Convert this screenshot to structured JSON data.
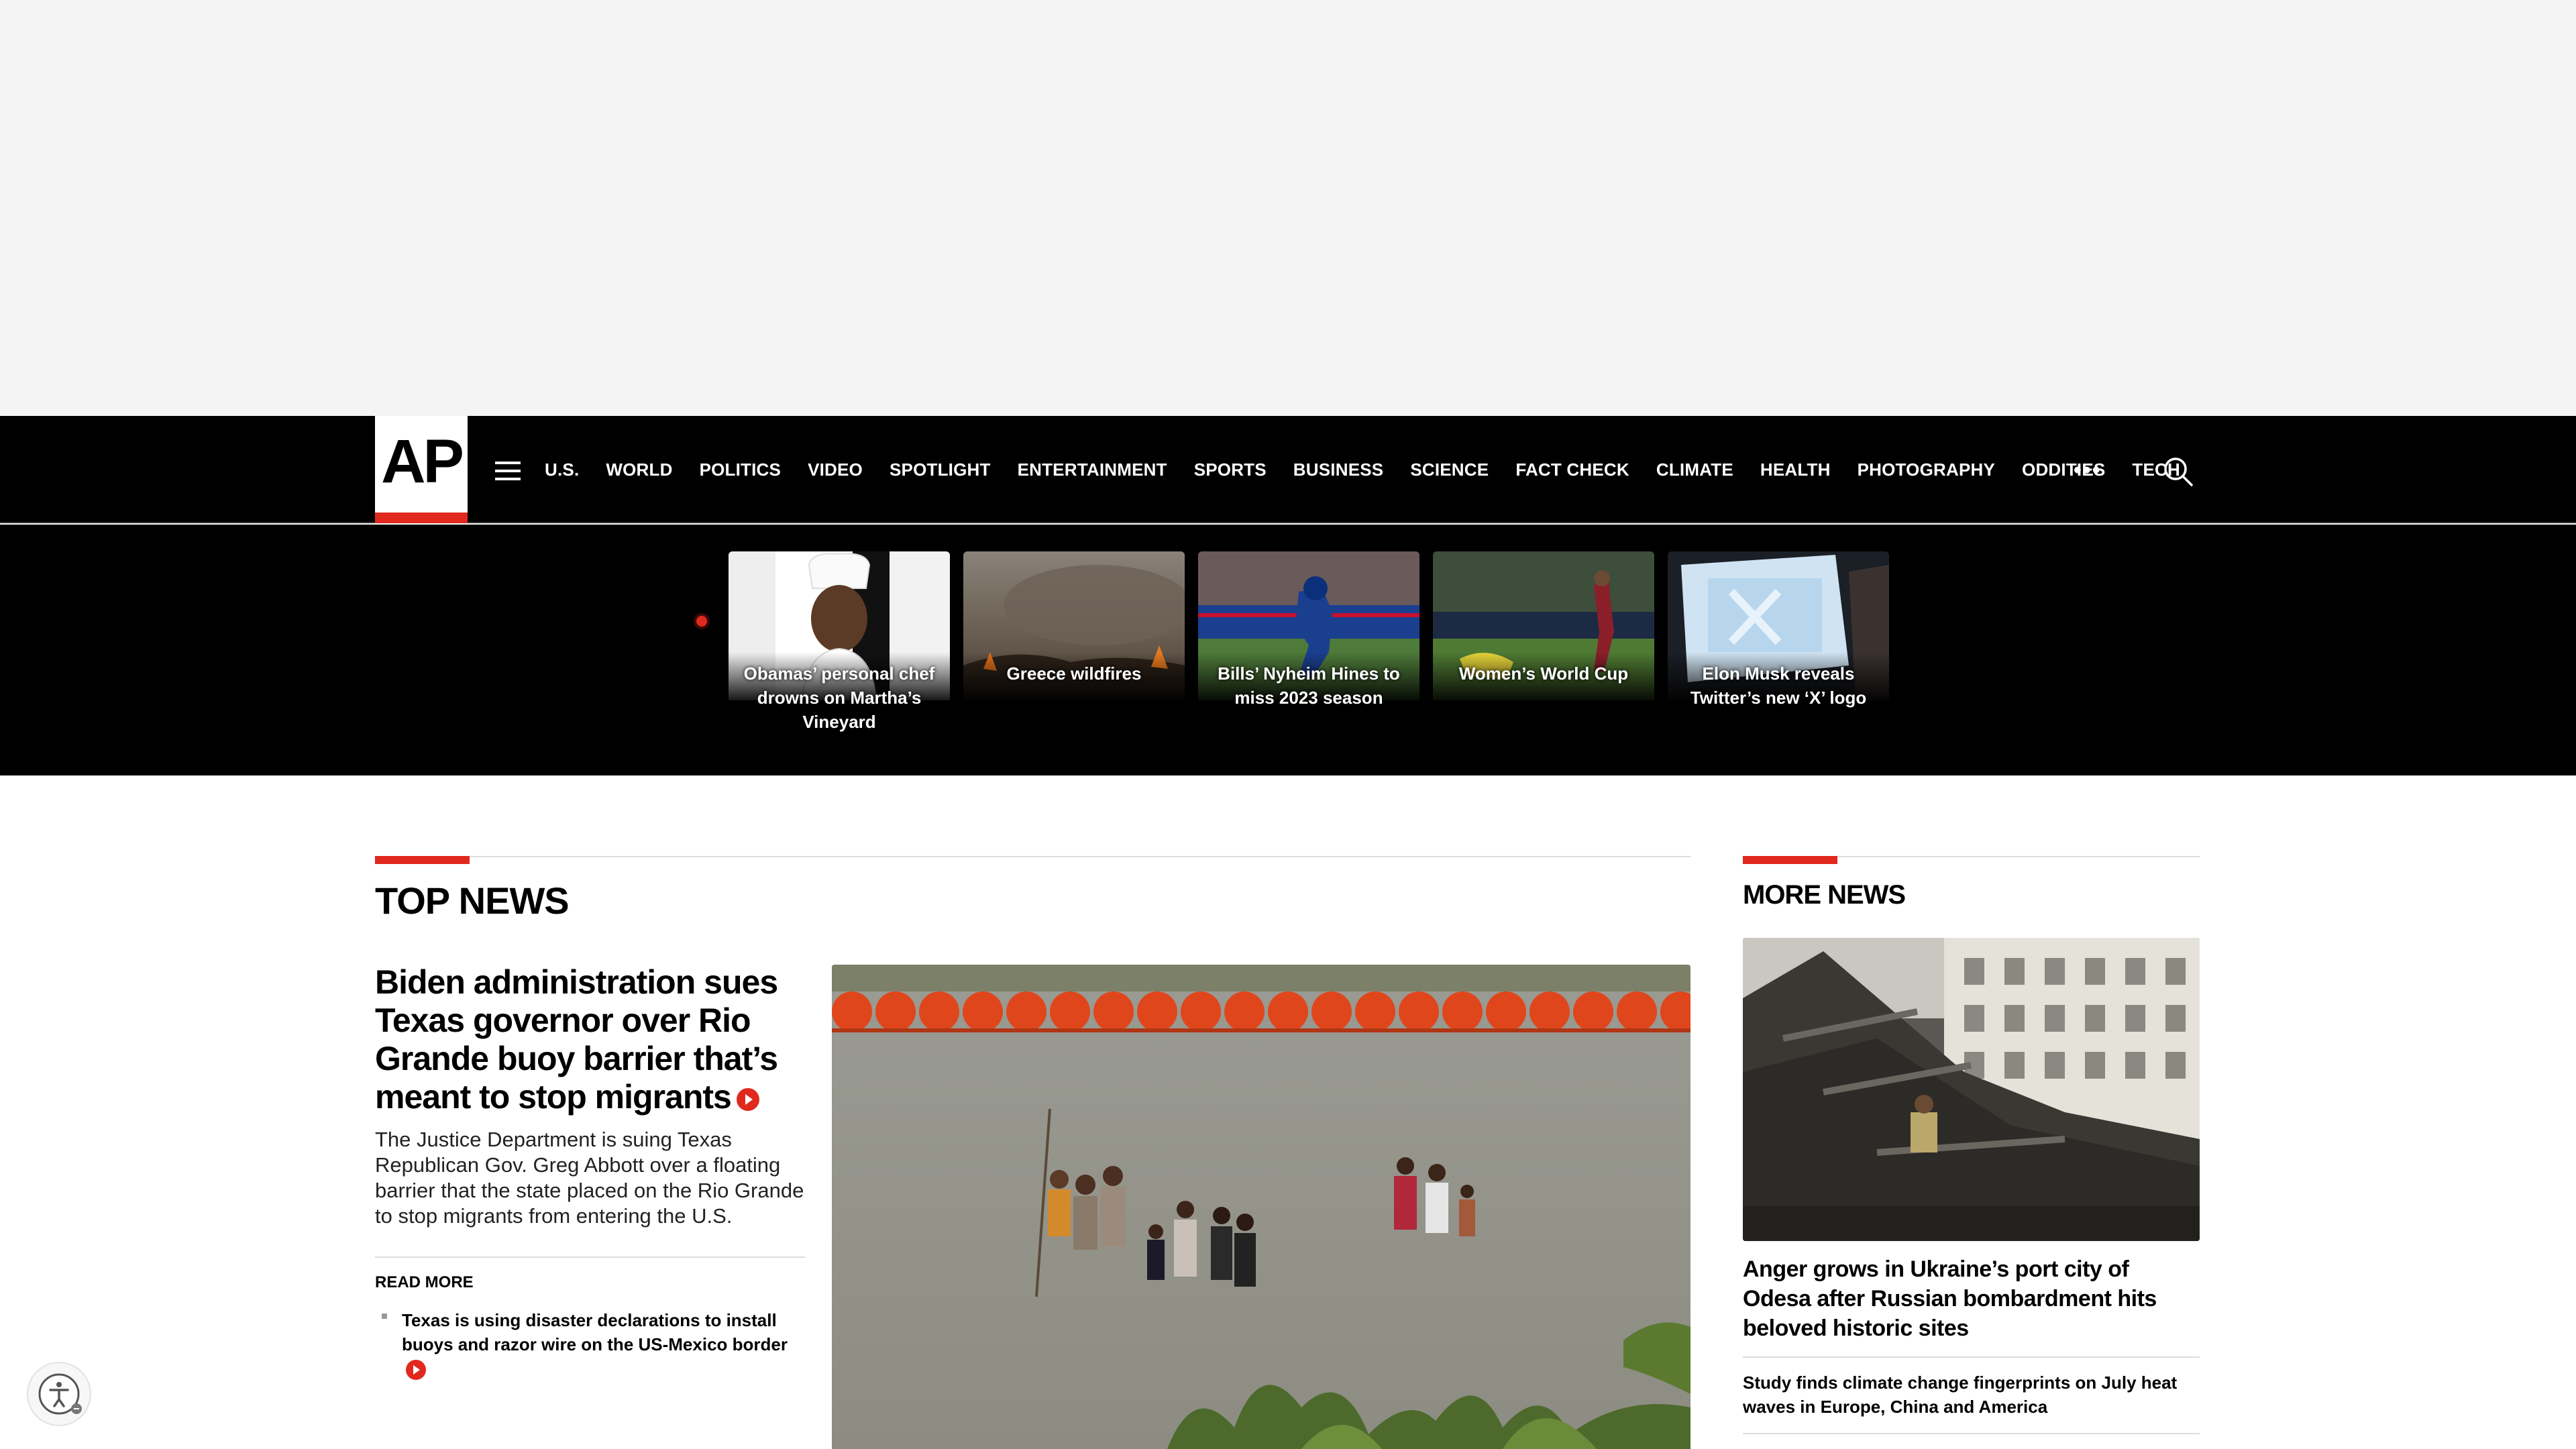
{
  "brand": {
    "logo_text": "AP",
    "accent": "#e1281e"
  },
  "nav": {
    "items": [
      "U.S.",
      "WORLD",
      "POLITICS",
      "VIDEO",
      "SPOTLIGHT",
      "ENTERTAINMENT",
      "SPORTS",
      "BUSINESS",
      "SCIENCE",
      "FACT CHECK",
      "CLIMATE",
      "HEALTH",
      "PHOTOGRAPHY",
      "ODDITIES",
      "TECH"
    ],
    "more_label": "•••",
    "menu_icon": "hamburger-icon",
    "search_icon": "search-icon"
  },
  "trending": [
    {
      "caption": "Obamas’ personal chef drowns on Martha’s Vineyard"
    },
    {
      "caption": "Greece wildfires"
    },
    {
      "caption": "Bills’ Nyheim Hines to miss 2023 season"
    },
    {
      "caption": "Women’s World Cup"
    },
    {
      "caption": "Elon Musk reveals Twitter’s new ‘X’ logo"
    }
  ],
  "top_news": {
    "title": "TOP NEWS",
    "lead": {
      "headline": "Biden administration sues Texas governor over Rio Grande buoy barrier that’s meant to stop migrants",
      "description": "The Justice Department is suing Texas Republican Gov. Greg Abbott over a floating barrier that the state placed on the Rio Grande to stop migrants from entering the U.S."
    },
    "read_more": "READ MORE",
    "related": "Texas is using disaster declarations to install buoys and razor wire on the US-Mexico border"
  },
  "more_news": {
    "title": "MORE NEWS",
    "headline": "Anger grows in Ukraine’s port city of Odesa after Russian bombardment hits beloved historic sites",
    "sub": "Study finds climate change fingerprints on July heat waves in Europe, China and America"
  },
  "accessibility": {
    "icon": "accessibility-icon"
  }
}
